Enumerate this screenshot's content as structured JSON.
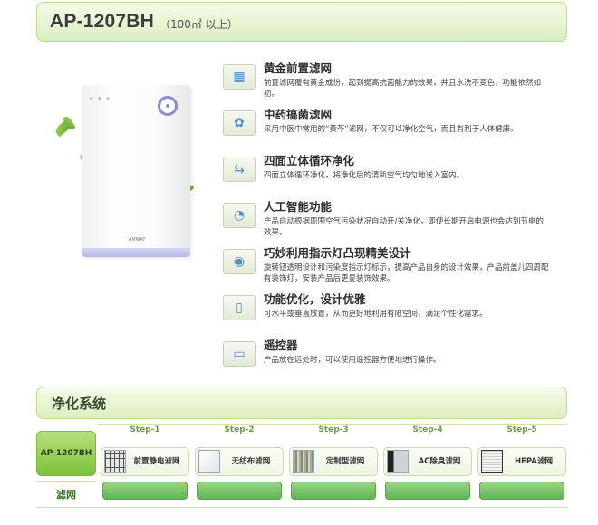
{
  "header": {
    "model": "AP-1207BH",
    "area": "（100㎡ 以上）"
  },
  "product": {
    "brand": "AMWAY"
  },
  "features": [
    {
      "icon": "gold-filter-icon",
      "title": "黄金前置滤网",
      "desc": "前置滤网覆有黄金成份，起到提高抗菌能力的效果，并且水洗不变色，功能依然如初。"
    },
    {
      "icon": "herbal-filter-icon",
      "title": "中药搞菌滤网",
      "desc": "采用中医中常用的“黄芩”滤网，不仅可以净化空气，而且有利于人体健康。"
    },
    {
      "icon": "airflow-icon",
      "title": "四面立体循环净化",
      "desc": "四面立体循环净化，将净化后的清新空气均匀地送入室内。"
    },
    {
      "icon": "smart-icon",
      "title": "人工智能功能",
      "desc": "产品自动根据周围空气污染状况自动开/关净化，即使长期开启电源也会达到节电的效果。"
    },
    {
      "icon": "indicator-light-icon",
      "title": "巧妙利用指示灯凸现精美设计",
      "desc": "旋转钮透明设计和污染度指示灯标示，提高产品自身的设计效果，产品前盖儿四周配有装饰灯，安装产品后更显装饰效果。"
    },
    {
      "icon": "placement-icon",
      "title": "功能优化，设计优雅",
      "desc": "可水平或垂直放置，从而更好地利用有限空间，满足个性化需求。"
    },
    {
      "icon": "remote-icon",
      "title": "遥控器",
      "desc": "产品放在远处时，可以使用遥控器方便地进行操作。"
    }
  ],
  "system": {
    "title": "净化系统",
    "model_label": "AP-1207BH",
    "filter_label": "滤网",
    "steps": [
      {
        "step": "Step-1",
        "name": "前置静电滤网"
      },
      {
        "step": "Step-2",
        "name": "无纺布滤网"
      },
      {
        "step": "Step-3",
        "name": "定制型滤网"
      },
      {
        "step": "Step-4",
        "name": "AC除臭滤网"
      },
      {
        "step": "Step-5",
        "name": "HEPA滤网"
      }
    ]
  }
}
